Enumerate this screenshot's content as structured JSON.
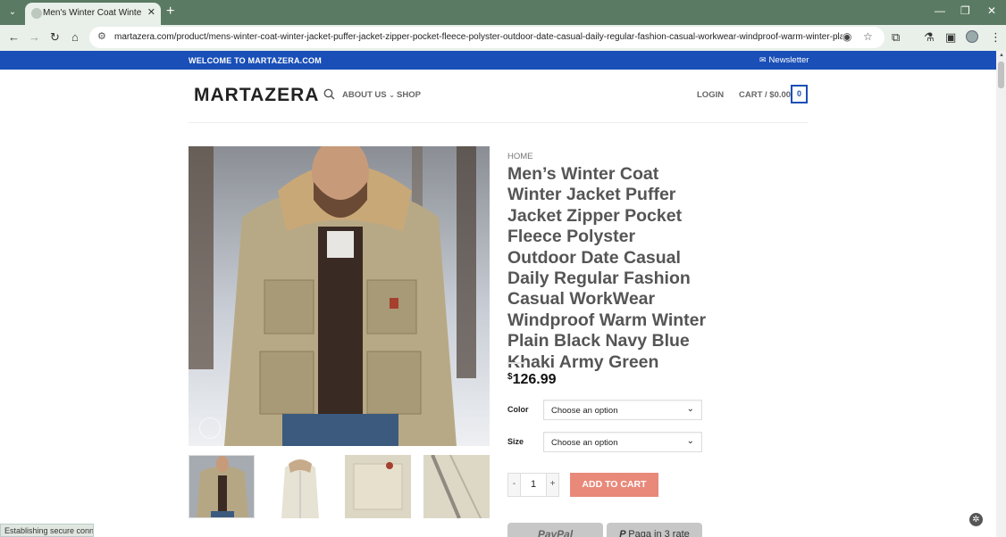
{
  "browser": {
    "tab_title": "Men's Winter Coat Winter Jacke",
    "url": "martazera.com/product/mens-winter-coat-winter-jacket-puffer-jacket-zipper-pocket-fleece-polyster-outdoor-date-casual-daily-regular-fashion-casual-workwear-windproof-warm-winter-plain-black...",
    "status": "Establishing secure conne..."
  },
  "topbar": {
    "welcome": "WELCOME TO MARTAZERA.COM",
    "newsletter": "Newsletter"
  },
  "header": {
    "logo": "MARTAZERA",
    "nav": {
      "about": "ABOUT US",
      "shop": "SHOP"
    },
    "login": "LOGIN",
    "cart": "CART / $0.00",
    "cart_count": "0"
  },
  "product": {
    "breadcrumb": "HOME",
    "title": "Men’s Winter Coat Winter Jacket Puffer Jacket Zipper Pocket Fleece Polyster Outdoor Date Casual Daily Regular Fashion Casual WorkWear Windproof Warm Winter Plain Black Navy Blue Khaki Army Green",
    "price_symbol": "$",
    "price": "126.99",
    "color_label": "Color",
    "color_placeholder": "Choose an option",
    "size_label": "Size",
    "size_placeholder": "Choose an option",
    "qty_minus": "-",
    "qty": "1",
    "qty_plus": "+",
    "add_to_cart": "ADD TO CART",
    "paypal": "PayPal",
    "paga": "Paga in 3 rate"
  },
  "colors": {
    "brand_blue": "#1a4fb8",
    "add_to_cart": "#e8897a",
    "browser_tab": "#5b7a63"
  }
}
